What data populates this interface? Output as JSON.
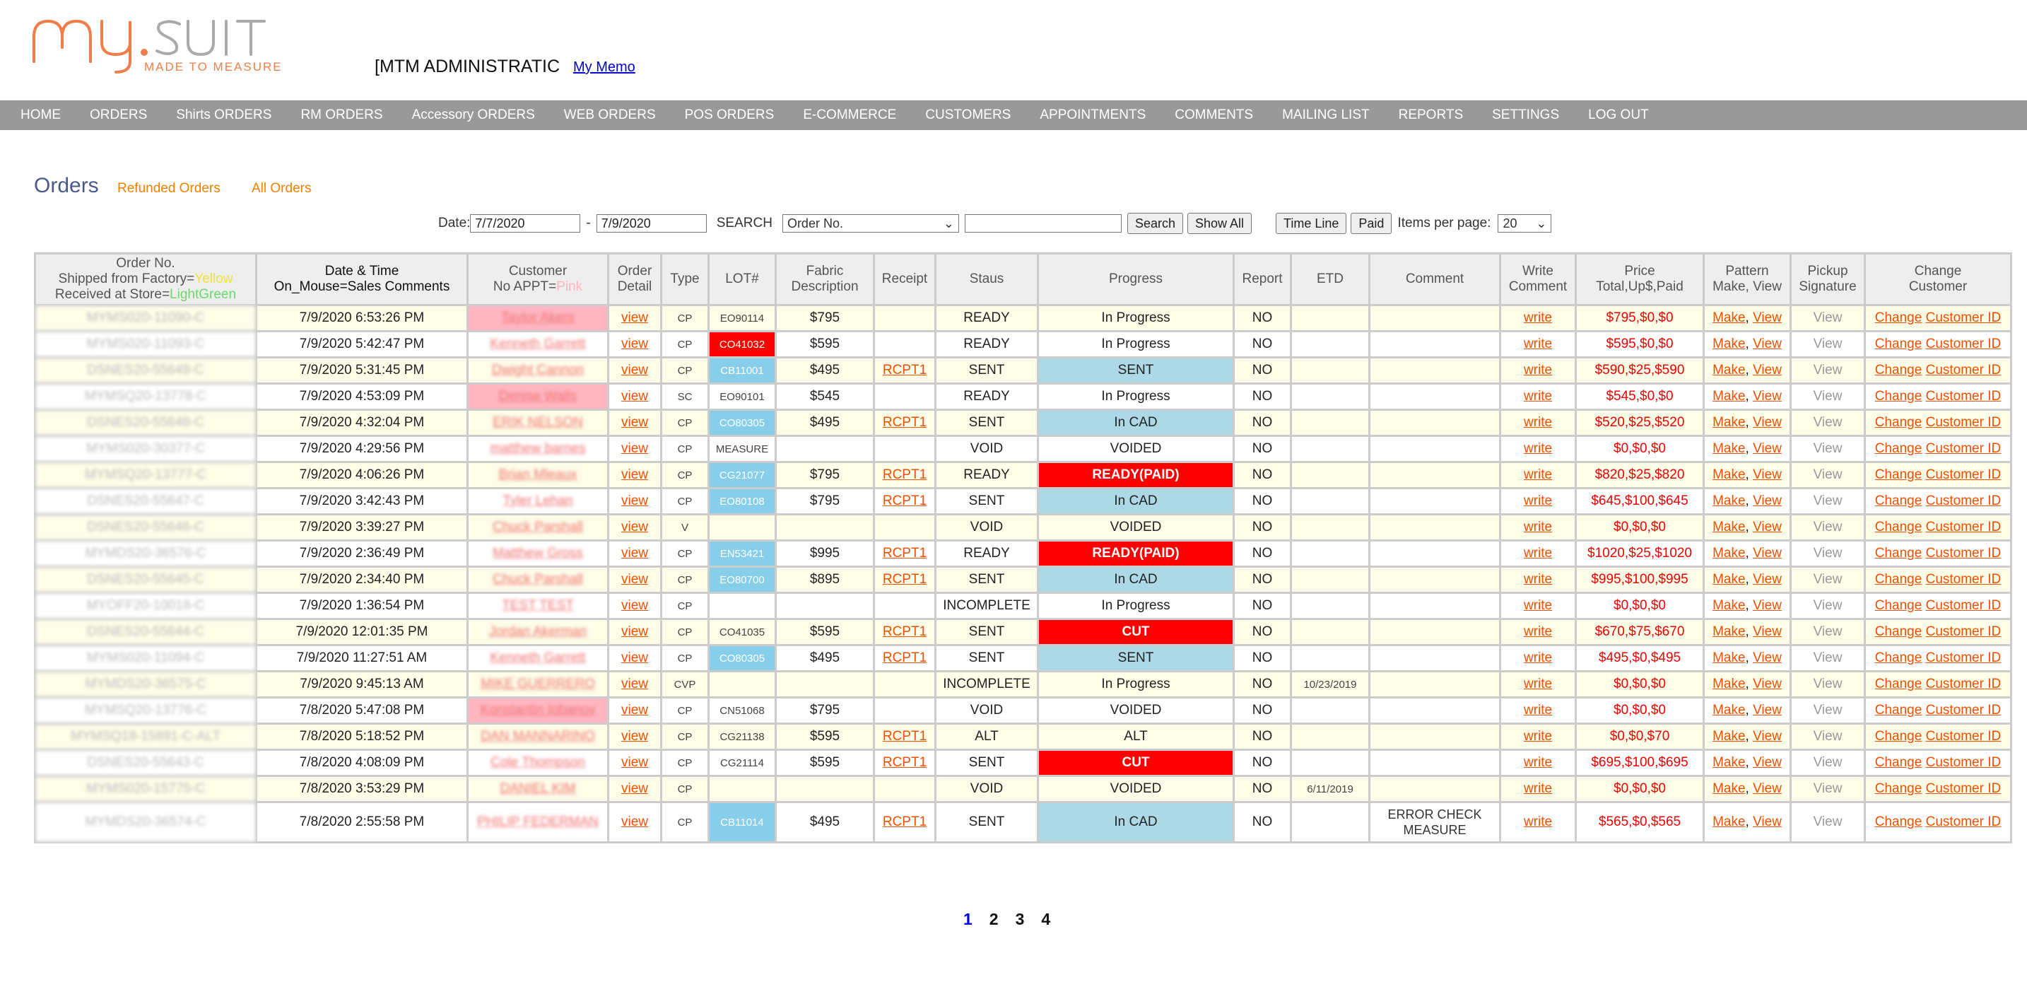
{
  "header": {
    "logo_main": "my.suit",
    "logo_tagline": "MADE TO MEASURE",
    "admin_title": "[MTM ADMINISTRATIC",
    "memo_link": "My Memo"
  },
  "nav": [
    "HOME",
    "ORDERS",
    "Shirts ORDERS",
    "RM ORDERS",
    "Accessory ORDERS",
    "WEB ORDERS",
    "POS ORDERS",
    "E-COMMERCE",
    "CUSTOMERS",
    "APPOINTMENTS",
    "COMMENTS",
    "MAILING LIST",
    "REPORTS",
    "SETTINGS",
    "LOG OUT"
  ],
  "page": {
    "title": "Orders",
    "refunded_link": "Refunded Orders",
    "all_link": "All Orders"
  },
  "filters": {
    "date_label": "Date:",
    "date_from": "7/7/2020",
    "dash": "-",
    "date_to": "7/9/2020",
    "search_label": "SEARCH",
    "search_field": "Order No.",
    "search_value": "",
    "search_button": "Search",
    "show_all_button": "Show All",
    "timeline_button": "Time Line",
    "paid_button": "Paid",
    "items_label": "Items per page:",
    "items_value": "20"
  },
  "columns": {
    "order_no_1": "Order No.",
    "order_no_2": "Shipped from Factory=",
    "order_no_2b": "Yellow",
    "order_no_3": "Received at Store=",
    "order_no_3b": "LightGreen",
    "datetime_1": "Date & Time",
    "datetime_2": "On_Mouse=Sales Comments",
    "customer_1": "Customer",
    "customer_2": "No APPT=",
    "customer_2b": "Pink",
    "order_detail_1": "Order",
    "order_detail_2": "Detail",
    "type": "Type",
    "lot": "LOT#",
    "fabric_1": "Fabric",
    "fabric_2": "Description",
    "receipt": "Receipt",
    "status": "Staus",
    "progress": "Progress",
    "report": "Report",
    "etd": "ETD",
    "comment": "Comment",
    "write_1": "Write",
    "write_2": "Comment",
    "price_1": "Price",
    "price_2": "Total,Up$,Paid",
    "pattern_1": "Pattern",
    "pattern_2": "Make, View",
    "pickup_1": "Pickup",
    "pickup_2": "Signature",
    "change_1": "Change",
    "change_2": "Customer"
  },
  "links": {
    "view": "view",
    "write": "write",
    "make": "Make",
    "pattern_view": "View",
    "pickup_view": "View",
    "change": "Change",
    "customer_id": "Customer ID",
    "comma": ","
  },
  "rows": [
    {
      "order_no": "MYMS020-11090-C",
      "datetime": "7/9/2020 6:53:26 PM",
      "customer": "Taylor Akers",
      "cust_pink": true,
      "type": "CP",
      "lot": "EO90114",
      "lot_color": "",
      "fabric": "$795",
      "receipt": "",
      "status": "READY",
      "progress": "In Progress",
      "prog_color": "",
      "report": "NO",
      "etd": "",
      "comment": "",
      "price": "$795,$0,$0"
    },
    {
      "order_no": "MYMS020-11093-C",
      "datetime": "7/9/2020 5:42:47 PM",
      "customer": "Kenneth Garrett",
      "cust_pink": false,
      "type": "CP",
      "lot": "CO41032",
      "lot_color": "red",
      "fabric": "$595",
      "receipt": "",
      "status": "READY",
      "progress": "In Progress",
      "prog_color": "",
      "report": "NO",
      "etd": "",
      "comment": "",
      "price": "$595,$0,$0"
    },
    {
      "order_no": "DSNES20-55649-C",
      "datetime": "7/9/2020 5:31:45 PM",
      "customer": "Dwight Cannon",
      "cust_pink": false,
      "type": "CP",
      "lot": "CB11001",
      "lot_color": "blue",
      "fabric": "$495",
      "receipt": "RCPT1",
      "status": "SENT",
      "progress": "SENT",
      "prog_color": "blue",
      "report": "NO",
      "etd": "",
      "comment": "",
      "price": "$590,$25,$590"
    },
    {
      "order_no": "MYMSQ20-13778-C",
      "datetime": "7/9/2020 4:53:09 PM",
      "customer": "Denise Walls",
      "cust_pink": true,
      "type": "SC",
      "lot": "EO90101",
      "lot_color": "",
      "fabric": "$545",
      "receipt": "",
      "status": "READY",
      "progress": "In Progress",
      "prog_color": "",
      "report": "NO",
      "etd": "",
      "comment": "",
      "price": "$545,$0,$0"
    },
    {
      "order_no": "DSNES20-55648-C",
      "datetime": "7/9/2020 4:32:04 PM",
      "customer": "ERIK NELSON",
      "cust_pink": false,
      "type": "CP",
      "lot": "CO80305",
      "lot_color": "blue",
      "fabric": "$495",
      "receipt": "RCPT1",
      "status": "SENT",
      "progress": "In CAD",
      "prog_color": "blue",
      "report": "NO",
      "etd": "",
      "comment": "",
      "price": "$520,$25,$520"
    },
    {
      "order_no": "MYMS020-30377-C",
      "datetime": "7/9/2020 4:29:56 PM",
      "customer": "matthew barnes",
      "cust_pink": false,
      "type": "CP",
      "lot": "MEASURE",
      "lot_color": "",
      "fabric": "",
      "receipt": "",
      "status": "VOID",
      "progress": "VOIDED",
      "prog_color": "",
      "report": "NO",
      "etd": "",
      "comment": "",
      "price": "$0,$0,$0"
    },
    {
      "order_no": "MYMSQ20-13777-C",
      "datetime": "7/9/2020 4:06:26 PM",
      "customer": "Brian Mleaux",
      "cust_pink": false,
      "type": "CP",
      "lot": "CG21077",
      "lot_color": "blue",
      "fabric": "$795",
      "receipt": "RCPT1",
      "status": "READY",
      "progress": "READY(PAID)",
      "prog_color": "red",
      "report": "NO",
      "etd": "",
      "comment": "",
      "price": "$820,$25,$820"
    },
    {
      "order_no": "DSNES20-55647-C",
      "datetime": "7/9/2020 3:42:43 PM",
      "customer": "Tyler Lehan",
      "cust_pink": false,
      "type": "CP",
      "lot": "EO80108",
      "lot_color": "blue",
      "fabric": "$795",
      "receipt": "RCPT1",
      "status": "SENT",
      "progress": "In CAD",
      "prog_color": "blue",
      "report": "NO",
      "etd": "",
      "comment": "",
      "price": "$645,$100,$645"
    },
    {
      "order_no": "DSNES20-55646-C",
      "datetime": "7/9/2020 3:39:27 PM",
      "customer": "Chuck Parshall",
      "cust_pink": false,
      "type": "V",
      "lot": "",
      "lot_color": "",
      "fabric": "",
      "receipt": "",
      "status": "VOID",
      "progress": "VOIDED",
      "prog_color": "",
      "report": "NO",
      "etd": "",
      "comment": "",
      "price": "$0,$0,$0"
    },
    {
      "order_no": "MYMDS20-36576-C",
      "datetime": "7/9/2020 2:36:49 PM",
      "customer": "Matthew Gross",
      "cust_pink": false,
      "type": "CP",
      "lot": "EN53421",
      "lot_color": "blue",
      "fabric": "$995",
      "receipt": "RCPT1",
      "status": "READY",
      "progress": "READY(PAID)",
      "prog_color": "red",
      "report": "NO",
      "etd": "",
      "comment": "",
      "price": "$1020,$25,$1020"
    },
    {
      "order_no": "DSNES20-55645-C",
      "datetime": "7/9/2020 2:34:40 PM",
      "customer": "Chuck Parshall",
      "cust_pink": false,
      "type": "CP",
      "lot": "EO80700",
      "lot_color": "blue",
      "fabric": "$895",
      "receipt": "RCPT1",
      "status": "SENT",
      "progress": "In CAD",
      "prog_color": "blue",
      "report": "NO",
      "etd": "",
      "comment": "",
      "price": "$995,$100,$995"
    },
    {
      "order_no": "MYOFF20-10018-C",
      "datetime": "7/9/2020 1:36:54 PM",
      "customer": "TEST TEST",
      "cust_pink": false,
      "type": "CP",
      "lot": "",
      "lot_color": "",
      "fabric": "",
      "receipt": "",
      "status": "INCOMPLETE",
      "progress": "In Progress",
      "prog_color": "",
      "report": "NO",
      "etd": "",
      "comment": "",
      "price": "$0,$0,$0"
    },
    {
      "order_no": "DSNES20-55644-C",
      "datetime": "7/9/2020 12:01:35 PM",
      "customer": "Jordan Akerman",
      "cust_pink": false,
      "type": "CP",
      "lot": "CO41035",
      "lot_color": "",
      "fabric": "$595",
      "receipt": "RCPT1",
      "status": "SENT",
      "progress": "CUT",
      "prog_color": "red",
      "report": "NO",
      "etd": "",
      "comment": "",
      "price": "$670,$75,$670"
    },
    {
      "order_no": "MYMS020-11094-C",
      "datetime": "7/9/2020 11:27:51 AM",
      "customer": "Kenneth Garrett",
      "cust_pink": false,
      "type": "CP",
      "lot": "CO80305",
      "lot_color": "blue",
      "fabric": "$495",
      "receipt": "RCPT1",
      "status": "SENT",
      "progress": "SENT",
      "prog_color": "blue",
      "report": "NO",
      "etd": "",
      "comment": "",
      "price": "$495,$0,$495"
    },
    {
      "order_no": "MYMDS20-36575-C",
      "datetime": "7/9/2020 9:45:13 AM",
      "customer": "MIKE GUERRERO",
      "cust_pink": false,
      "type": "CVP",
      "lot": "",
      "lot_color": "",
      "fabric": "",
      "receipt": "",
      "status": "INCOMPLETE",
      "progress": "In Progress",
      "prog_color": "",
      "report": "NO",
      "etd": "10/23/2019",
      "comment": "",
      "price": "$0,$0,$0"
    },
    {
      "order_no": "MYMSQ20-13776-C",
      "datetime": "7/8/2020 5:47:08 PM",
      "customer": "Konstantin Iobanov",
      "cust_pink": true,
      "type": "CP",
      "lot": "CN51068",
      "lot_color": "",
      "fabric": "$795",
      "receipt": "",
      "status": "VOID",
      "progress": "VOIDED",
      "prog_color": "",
      "report": "NO",
      "etd": "",
      "comment": "",
      "price": "$0,$0,$0"
    },
    {
      "order_no": "MYMSQ18-15891-C-ALT",
      "datetime": "7/8/2020 5:18:52 PM",
      "customer": "DAN MANNARINO",
      "cust_pink": false,
      "type": "CP",
      "lot": "CG21138",
      "lot_color": "",
      "fabric": "$595",
      "receipt": "RCPT1",
      "status": "ALT",
      "progress": "ALT",
      "prog_color": "",
      "report": "NO",
      "etd": "",
      "comment": "",
      "price": "$0,$0,$70"
    },
    {
      "order_no": "DSNES20-55643-C",
      "datetime": "7/8/2020 4:08:09 PM",
      "customer": "Cole Thompson",
      "cust_pink": false,
      "type": "CP",
      "lot": "CG21114",
      "lot_color": "",
      "fabric": "$595",
      "receipt": "RCPT1",
      "status": "SENT",
      "progress": "CUT",
      "prog_color": "red",
      "report": "NO",
      "etd": "",
      "comment": "",
      "price": "$695,$100,$695"
    },
    {
      "order_no": "MYMS020-15775-C",
      "datetime": "7/8/2020 3:53:29 PM",
      "customer": "DANIEL KIM",
      "cust_pink": false,
      "type": "CP",
      "lot": "",
      "lot_color": "",
      "fabric": "",
      "receipt": "",
      "status": "VOID",
      "progress": "VOIDED",
      "prog_color": "",
      "report": "NO",
      "etd": "6/11/2019",
      "comment": "",
      "price": "$0,$0,$0"
    },
    {
      "order_no": "MYMDS20-36574-C",
      "datetime": "7/8/2020 2:55:58 PM",
      "customer": "PHILIP FEDERMAN",
      "cust_pink": false,
      "type": "CP",
      "lot": "CB11014",
      "lot_color": "blue",
      "fabric": "$495",
      "receipt": "RCPT1",
      "status": "SENT",
      "progress": "In CAD",
      "prog_color": "blue",
      "report": "NO",
      "etd": "",
      "comment": "ERROR CHECK MEASURE",
      "price": "$565,$0,$565"
    }
  ],
  "pagination": [
    "1",
    "2",
    "3",
    "4"
  ],
  "colors": {
    "nav_bg": "#999999",
    "title": "#4a5a8c",
    "link": "#f05000",
    "price": "#ee0000",
    "progress_blue": "#add8e6",
    "progress_red": "#ff0000",
    "lot_blue": "#87ceeb",
    "row_yellow": "#fdfde8",
    "cust_pink": "#ffb6c1"
  }
}
